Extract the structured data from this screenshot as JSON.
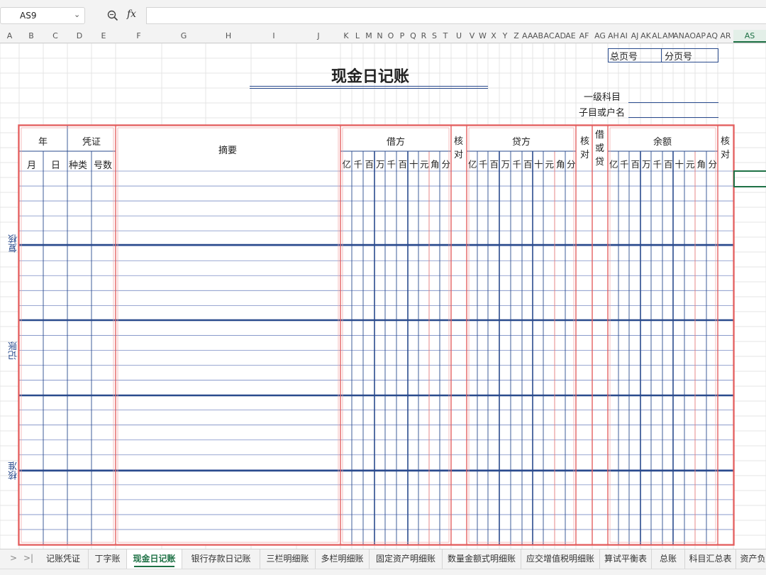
{
  "name_box": "AS9",
  "formula": "",
  "columns": [
    "A",
    "B",
    "C",
    "D",
    "E",
    "F",
    "G",
    "H",
    "I",
    "J",
    "K",
    "L",
    "M",
    "N",
    "O",
    "P",
    "Q",
    "R",
    "S",
    "T",
    "U",
    "V",
    "W",
    "X",
    "Y",
    "Z",
    "AA",
    "AB",
    "AC",
    "AD",
    "AE",
    "AF",
    "AG",
    "AH",
    "AI",
    "AJ",
    "AK",
    "AL",
    "AM",
    "AN",
    "AO",
    "AP",
    "AQ",
    "AR",
    "AS"
  ],
  "selected_column": "AS",
  "ledger": {
    "title": "现金日记账",
    "total_page_no": "总页号",
    "sub_page_no": "分页号",
    "level1_account": "一级科目",
    "sub_account": "子目或户名",
    "year": "年",
    "voucher": "凭证",
    "month": "月",
    "day": "日",
    "voucher_type": "种类",
    "voucher_no": "号数",
    "summary": "摘要",
    "debit": "借方",
    "credit": "贷方",
    "balance": "余额",
    "check": "核对",
    "debit_or_credit": "借或贷",
    "digit_units": [
      "亿",
      "千",
      "百",
      "万",
      "千",
      "百",
      "十",
      "元",
      "角",
      "分"
    ],
    "side_labels": [
      "复核",
      "记账",
      "核准"
    ]
  },
  "sheets": [
    "记账凭证",
    "丁字账",
    "现金日记账",
    "银行存款日记账",
    "三栏明细账",
    "多栏明细账",
    "固定资产明细账",
    "数量金额式明细账",
    "应交增值税明细账",
    "算试平衡表",
    "总账",
    "科目汇总表",
    "资产负债"
  ],
  "active_sheet": "现金日记账"
}
